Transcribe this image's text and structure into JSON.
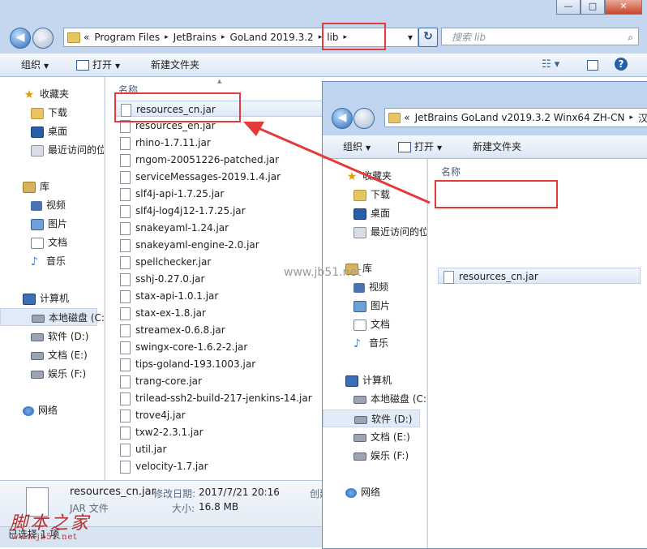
{
  "window_main": {
    "title_buttons": [
      "—",
      "□",
      "✕"
    ],
    "nav": {
      "back": "◀",
      "forward": "▶"
    },
    "address": {
      "overflow": "«",
      "crumbs": [
        "Program Files",
        "JetBrains",
        "GoLand 2019.3.2",
        "lib"
      ],
      "separator": "▸",
      "dropdown": "▾",
      "refresh": "↻"
    },
    "search_placeholder": "搜索 lib",
    "toolbar": {
      "organize": "组织",
      "open": "打开",
      "new_folder": "新建文件夹"
    },
    "nav_pane": [
      {
        "icon": "star",
        "label": "收藏夹"
      },
      {
        "icon": "folder",
        "label": "下载"
      },
      {
        "icon": "desk",
        "label": "桌面"
      },
      {
        "icon": "recent",
        "label": "最近访问的位"
      },
      {
        "icon": "lib",
        "label": "库"
      },
      {
        "icon": "video",
        "label": "视频"
      },
      {
        "icon": "pic",
        "label": "图片"
      },
      {
        "icon": "doc",
        "label": "文档"
      },
      {
        "icon": "music",
        "label": "音乐"
      },
      {
        "icon": "pc",
        "label": "计算机"
      },
      {
        "icon": "disk",
        "label": "本地磁盘 (C:"
      },
      {
        "icon": "disk",
        "label": "软件 (D:)"
      },
      {
        "icon": "disk",
        "label": "文档 (E:)"
      },
      {
        "icon": "disk",
        "label": "娱乐 (F:)"
      },
      {
        "icon": "net",
        "label": "网络"
      }
    ],
    "column_name": "名称",
    "files": [
      "resources_cn.jar",
      "resources_en.jar",
      "rhino-1.7.11.jar",
      "rngom-20051226-patched.jar",
      "serviceMessages-2019.1.4.jar",
      "slf4j-api-1.7.25.jar",
      "slf4j-log4j12-1.7.25.jar",
      "snakeyaml-1.24.jar",
      "snakeyaml-engine-2.0.jar",
      "spellchecker.jar",
      "sshj-0.27.0.jar",
      "stax-api-1.0.1.jar",
      "stax-ex-1.8.jar",
      "streamex-0.6.8.jar",
      "swingx-core-1.6.2-2.jar",
      "tips-goland-193.1003.jar",
      "trang-core.jar",
      "trilead-ssh2-build-217-jenkins-14.jar",
      "trove4j.jar",
      "txw2-2.3.1.jar",
      "util.jar",
      "velocity-1.7.jar"
    ],
    "details": {
      "name": "resources_cn.jar",
      "type": "JAR 文件",
      "modified_label": "修改日期:",
      "modified_value": "2017/7/21 20:16",
      "size_label": "大小:",
      "size_value": "16.8 MB",
      "created_label": "创建"
    },
    "status": "已选择 1 项"
  },
  "window_second": {
    "nav": {
      "back": "◀"
    },
    "address": {
      "overflow": "«",
      "crumb": "JetBrains GoLand v2019.3.2 Winx64 ZH-CN",
      "separator": "▸",
      "tail": "汉"
    },
    "toolbar": {
      "organize": "组织",
      "open": "打开",
      "new_folder": "新建文件夹"
    },
    "nav_pane": [
      {
        "icon": "star",
        "label": "收藏夹"
      },
      {
        "icon": "folder",
        "label": "下载"
      },
      {
        "icon": "desk",
        "label": "桌面"
      },
      {
        "icon": "recent",
        "label": "最近访问的位"
      },
      {
        "icon": "lib",
        "label": "库"
      },
      {
        "icon": "video",
        "label": "视频"
      },
      {
        "icon": "pic",
        "label": "图片"
      },
      {
        "icon": "doc",
        "label": "文档"
      },
      {
        "icon": "music",
        "label": "音乐"
      },
      {
        "icon": "pc",
        "label": "计算机"
      },
      {
        "icon": "disk",
        "label": "本地磁盘 (C:"
      },
      {
        "icon": "disk",
        "label": "软件 (D:)"
      },
      {
        "icon": "disk",
        "label": "文档 (E:)"
      },
      {
        "icon": "disk",
        "label": "娱乐 (F:)"
      },
      {
        "icon": "net",
        "label": "网络"
      }
    ],
    "column_name": "名称",
    "files": [
      "resources_cn.jar"
    ]
  },
  "watermarks": {
    "center": "www.jb51.net",
    "logo": "脚本之家",
    "logo_url": "www.jb51.net"
  },
  "colors": {
    "highlight_red": "#e33b3b",
    "selection_blue": "#dde9f8"
  }
}
